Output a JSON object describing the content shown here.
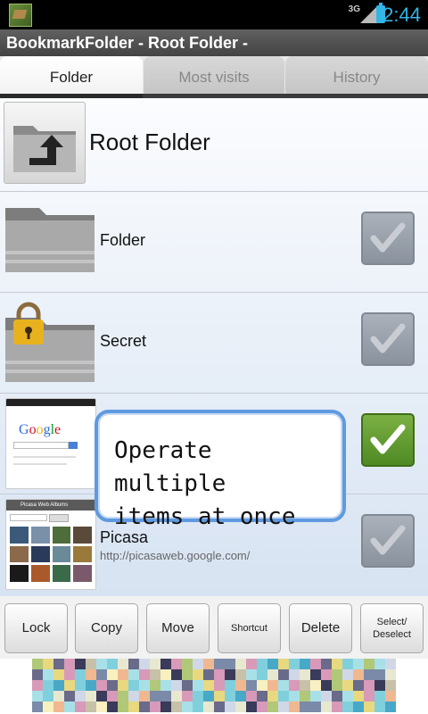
{
  "status_bar": {
    "network": "3G",
    "time": "2:44"
  },
  "title_bar": {
    "title": "BookmarkFolder - Root Folder -"
  },
  "tabs": [
    {
      "label": "Folder",
      "active": true
    },
    {
      "label": "Most visits",
      "active": false
    },
    {
      "label": "History",
      "active": false
    }
  ],
  "list": {
    "root": {
      "label": "Root Folder",
      "icon": "folder-up-icon"
    },
    "items": [
      {
        "label": "Folder",
        "subtitle": "",
        "icon": "folder-icon",
        "checked": false
      },
      {
        "label": "Secret",
        "subtitle": "",
        "icon": "locked-folder-icon",
        "checked": false
      },
      {
        "label": "",
        "subtitle": "",
        "icon": "google-thumbnail",
        "checked": true
      },
      {
        "label": "Picasa",
        "subtitle": "http://picasaweb.google.com/",
        "icon": "picasa-thumbnail",
        "checked": false
      }
    ]
  },
  "thumbnails": {
    "google_logo": "Google",
    "picasa_header": "Picasa Web Albums"
  },
  "toast": {
    "text": "Operate multiple\nitems at once"
  },
  "toolbar": {
    "lock": "Lock",
    "copy": "Copy",
    "move": "Move",
    "shortcut": "Shortcut",
    "delete": "Delete",
    "select_deselect": "Select/\nDeselect"
  },
  "colors": {
    "accent": "#33b5e5",
    "checked_green": "#5a9a2c",
    "toast_border": "#5f9ae0"
  }
}
